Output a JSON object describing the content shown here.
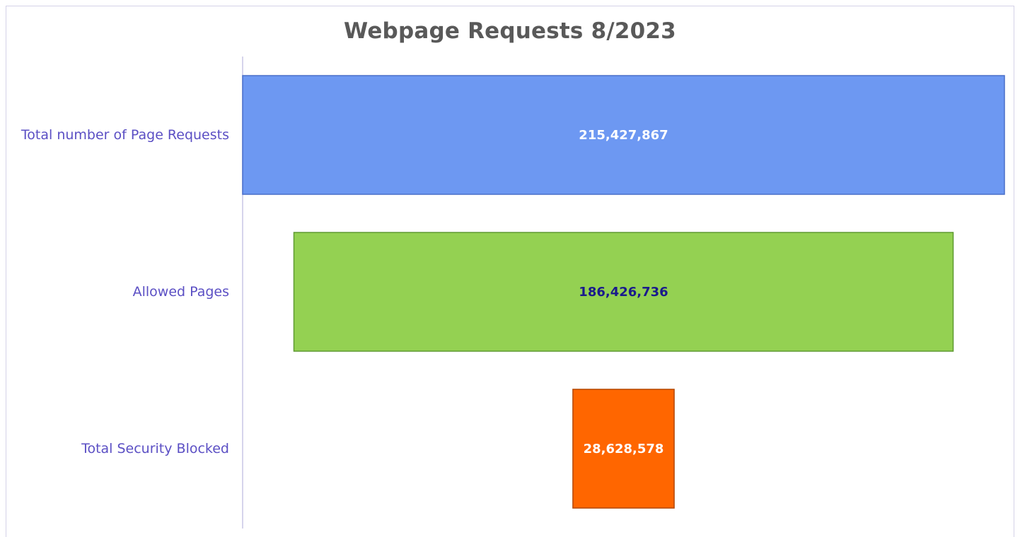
{
  "chart_data": {
    "type": "bar",
    "subtype": "funnel",
    "orientation": "horizontal",
    "title": "Webpage Requests 8/2023",
    "categories": [
      "Total number of Page Requests",
      "Allowed Pages",
      "Total Security Blocked"
    ],
    "values": [
      215427867,
      186426736,
      28628578
    ],
    "value_labels": [
      "215,427,867",
      "186,426,736",
      "28,628,578"
    ],
    "bar_colors": [
      "#6d98f2",
      "#94d152",
      "#ff6600"
    ],
    "bar_border_colors": [
      "#4a6fc9",
      "#5f9a32",
      "#b34700"
    ],
    "value_label_colors": [
      "#ffffff",
      "#1a1a8c",
      "#ffffff"
    ],
    "category_label_color": "#5b4fc4",
    "title_color": "#595959",
    "grid": false,
    "legend": "none"
  }
}
